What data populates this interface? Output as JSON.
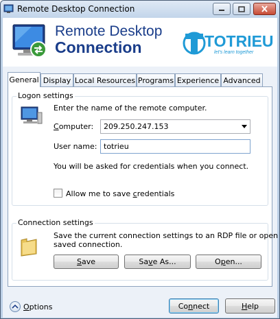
{
  "window": {
    "title": "Remote Desktop Connection",
    "controls": {
      "minimize": "minimize",
      "maximize": "maximize",
      "close": "close"
    }
  },
  "banner": {
    "title_line1": "Remote Desktop",
    "title_line2": "Connection",
    "logo_text": "TOTRIEU",
    "logo_tagline": "let's learn together"
  },
  "tabs": [
    {
      "label": "General",
      "active": true
    },
    {
      "label": "Display",
      "active": false
    },
    {
      "label": "Local Resources",
      "active": false
    },
    {
      "label": "Programs",
      "active": false
    },
    {
      "label": "Experience",
      "active": false
    },
    {
      "label": "Advanced",
      "active": false
    }
  ],
  "logon": {
    "group_label": "Logon settings",
    "instruction": "Enter the name of the remote computer.",
    "computer_label": "Computer:",
    "computer_value": "209.250.247.153",
    "username_label": "User name:",
    "username_value": "totrieu",
    "credentials_note": "You will be asked for credentials when you connect.",
    "save_credentials_label": "Allow me to save credentials",
    "save_credentials_checked": false
  },
  "connection": {
    "group_label": "Connection settings",
    "description_line1": "Save the current connection settings to an RDP file or open a",
    "description_line2": "saved connection.",
    "save_label": "Save",
    "save_as_label": "Save As...",
    "open_label": "Open..."
  },
  "footer": {
    "options_label": "Options",
    "connect_label": "Connect",
    "help_label": "Help"
  },
  "colors": {
    "banner_title": "#1a3d8a",
    "logo_blue": "#1f9ad6",
    "body_background": "#ecf1f8"
  },
  "icons": [
    "monitor-icon",
    "computer-icon",
    "folder-icon",
    "options-chevron-icon",
    "app-icon"
  ]
}
